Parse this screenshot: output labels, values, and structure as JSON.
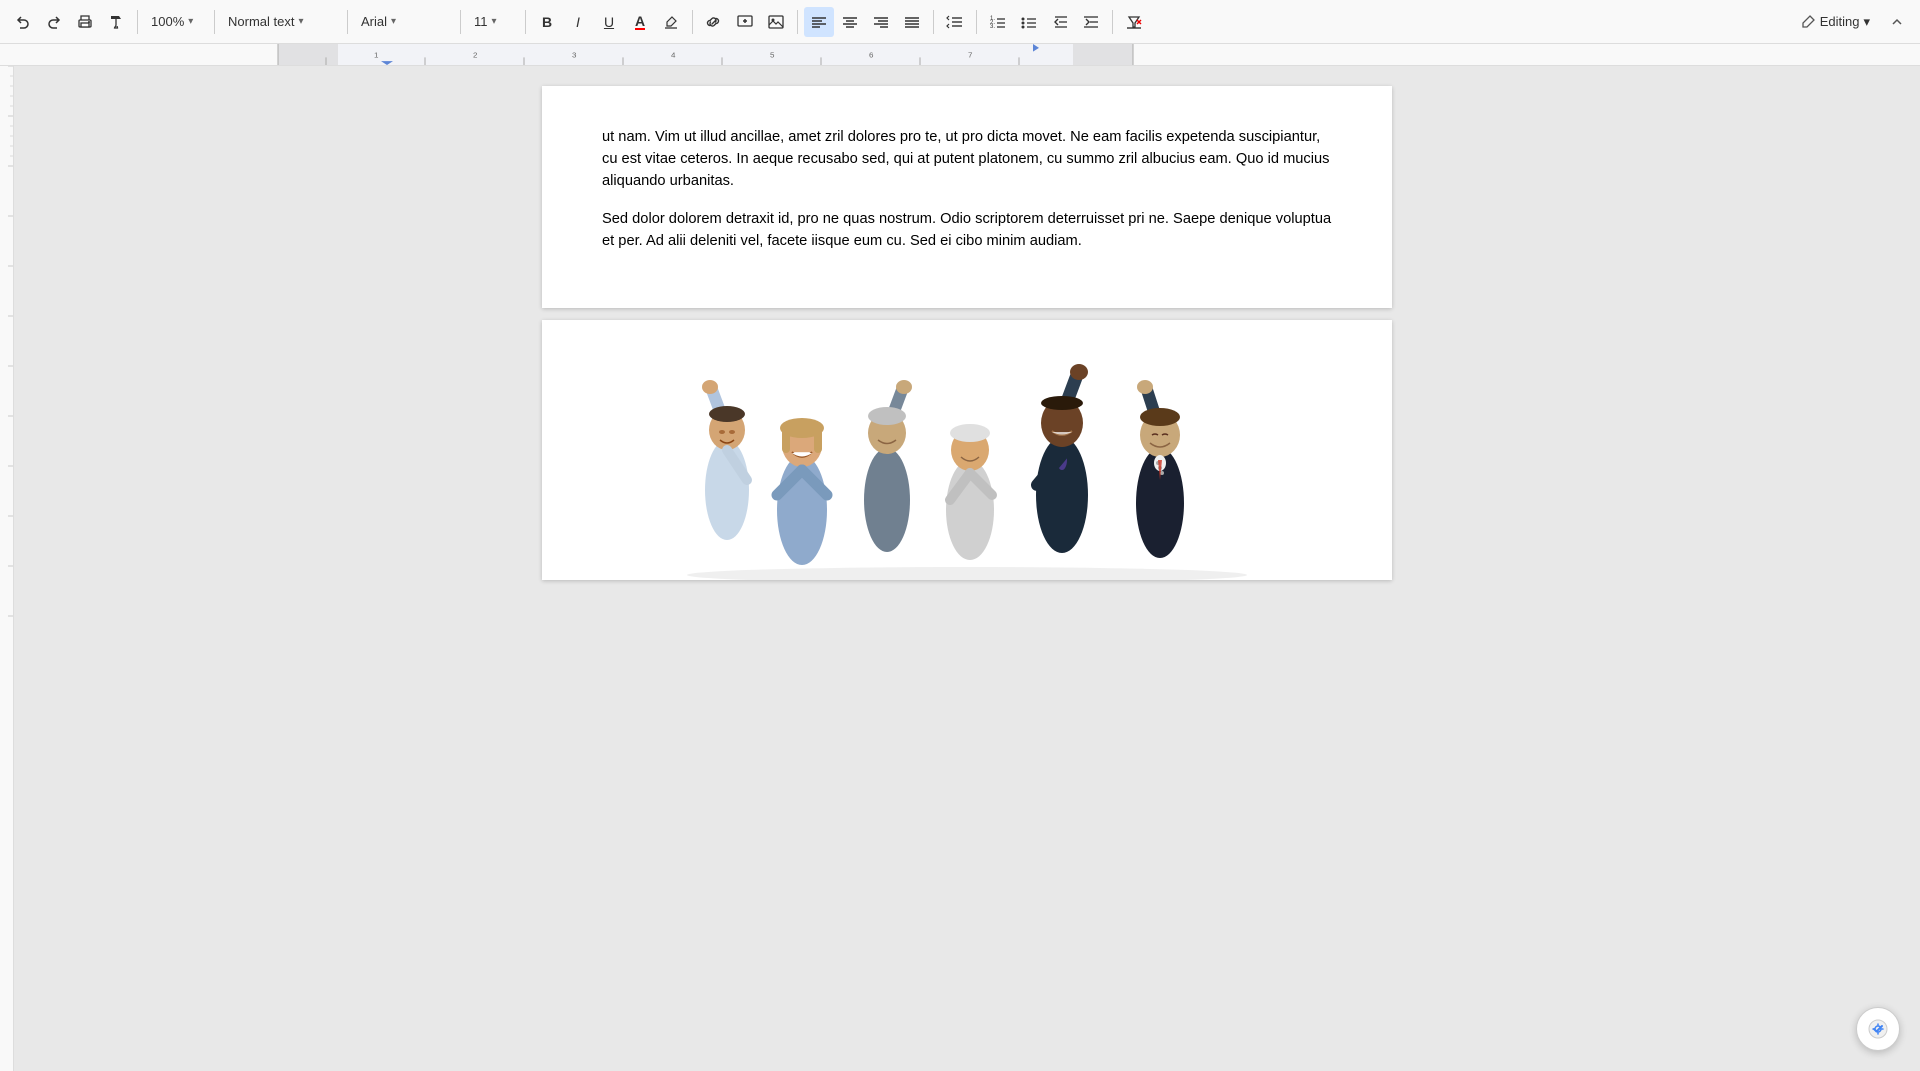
{
  "toolbar": {
    "undo_label": "↩",
    "redo_label": "↪",
    "print_label": "🖨",
    "paint_format_label": "🖌",
    "zoom_value": "100%",
    "zoom_arrow": "▾",
    "style_value": "Normal text",
    "style_arrow": "▾",
    "font_value": "Arial",
    "font_arrow": "▾",
    "size_value": "11",
    "size_arrow": "▾",
    "bold_label": "B",
    "italic_label": "I",
    "underline_label": "U",
    "text_color_label": "A",
    "highlight_label": "✎",
    "link_label": "🔗",
    "insert_link_label": "+",
    "image_label": "🖼",
    "align_left_label": "≡",
    "align_center_label": "≡",
    "align_right_label": "≡",
    "align_justify_label": "≡",
    "line_spacing_label": "↕",
    "numbered_list_label": "1.",
    "bulleted_list_label": "•",
    "indent_decrease_label": "⇤",
    "indent_increase_label": "⇥",
    "clear_format_label": "✕",
    "editing_label": "Editing",
    "editing_arrow": "▾",
    "collapse_label": "▲"
  },
  "document": {
    "paragraph1": "ut nam. Vim ut illud ancillae, amet zril dolores pro te, ut pro dicta movet. Ne eam facilis expetenda suscipiantur, cu est vitae ceteros. In aeque recusabo sed, qui at putent platonem, cu summo zril albucius eam. Quo id mucius aliquando urbanitas.",
    "paragraph2": "Sed dolor dolorem detraxit id, pro ne quas nostrum. Odio scriptorem deterruisset pri ne. Saepe denique voluptua et per. Ad alii deleniti vel, facete iisque eum cu. Sed ei cibo minim audiam."
  },
  "status": {
    "editing_icon": "✏"
  }
}
